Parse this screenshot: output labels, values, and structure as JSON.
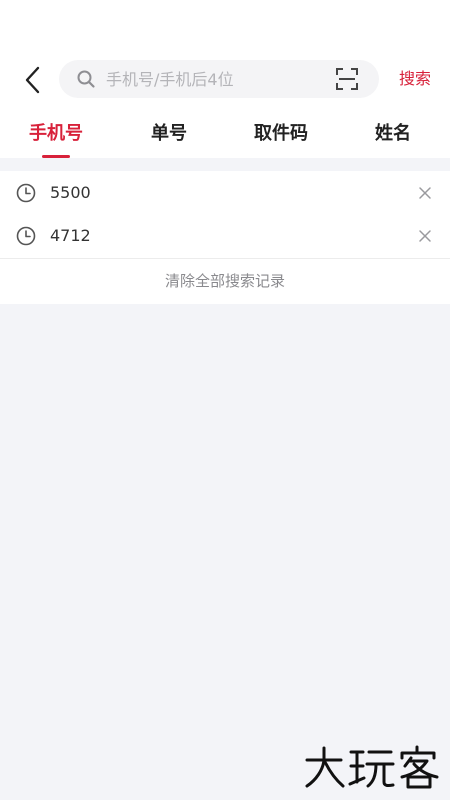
{
  "search": {
    "placeholder": "手机号/手机后4位",
    "value": "",
    "button_label": "搜索"
  },
  "tabs": [
    {
      "label": "手机号",
      "active": true
    },
    {
      "label": "单号",
      "active": false
    },
    {
      "label": "取件码",
      "active": false
    },
    {
      "label": "姓名",
      "active": false
    }
  ],
  "history": {
    "items": [
      {
        "text": "5500"
      },
      {
        "text": "4712"
      }
    ],
    "clear_label": "清除全部搜索记录"
  },
  "watermark": {
    "text": "大玩客"
  },
  "colors": {
    "accent": "#d8213a",
    "background": "#f3f4f8"
  },
  "icons": {
    "back": "back-arrow-icon",
    "search": "search-icon",
    "scan": "scan-icon",
    "history": "clock-icon",
    "delete": "close-icon"
  }
}
